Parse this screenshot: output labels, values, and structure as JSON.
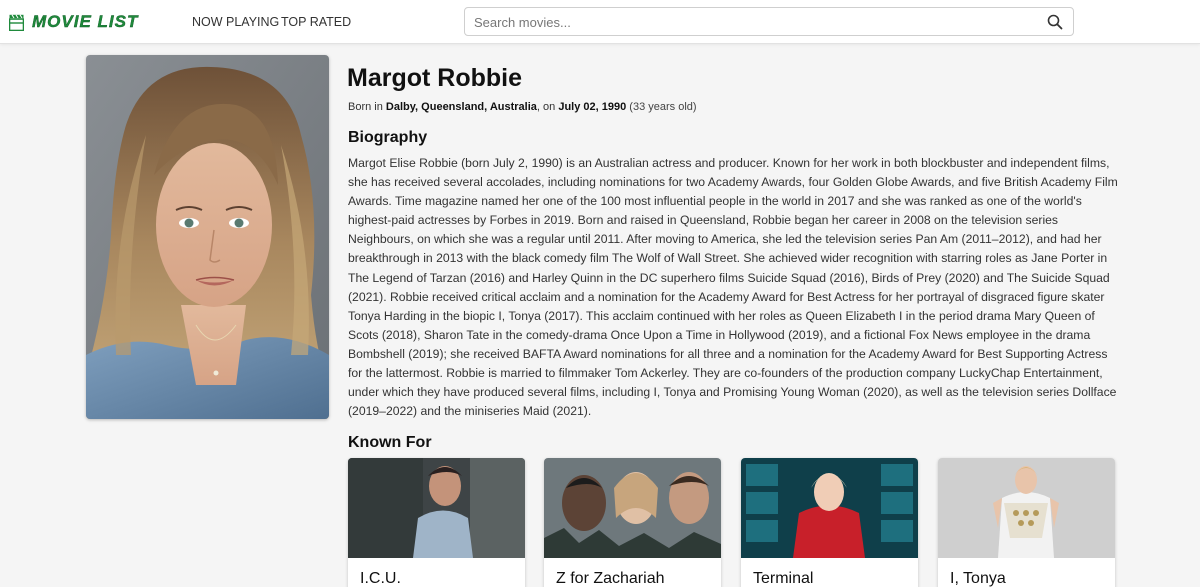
{
  "navbar": {
    "logo_text": "Movie List",
    "links": [
      "NOW PLAYING",
      "TOP RATED"
    ],
    "search_placeholder": "Search movies..."
  },
  "person": {
    "name": "Margot Robbie",
    "born_prefix": "Born in",
    "birthplace": "Dalby, Queensland, Australia",
    "on_text": ", on",
    "birthdate": "July 02, 1990",
    "age": "(33 years old)"
  },
  "biography": {
    "heading": "Biography",
    "text": "Margot Elise Robbie (born July 2, 1990) is an Australian actress and producer. Known for her work in both blockbuster and independent films, she has received several accolades, including nominations for two Academy Awards, four Golden Globe Awards, and five British Academy Film Awards. Time magazine named her one of the 100 most influential people in the world in 2017 and she was ranked as one of the world's highest-paid actresses by Forbes in 2019. Born and raised in Queensland, Robbie began her career in 2008 on the television series Neighbours, on which she was a regular until 2011. After moving to America, she led the television series Pan Am (2011–2012), and had her breakthrough in 2013 with the black comedy film The Wolf of Wall Street. She achieved wider recognition with starring roles as Jane Porter in The Legend of Tarzan (2016) and Harley Quinn in the DC superhero films Suicide Squad (2016), Birds of Prey (2020) and The Suicide Squad (2021). Robbie received critical acclaim and a nomination for the Academy Award for Best Actress for her portrayal of disgraced figure skater Tonya Harding in the biopic I, Tonya (2017). This acclaim continued with her roles as Queen Elizabeth I in the period drama Mary Queen of Scots (2018), Sharon Tate in the comedy-drama Once Upon a Time in Hollywood (2019), and a fictional Fox News employee in the drama Bombshell (2019); she received BAFTA Award nominations for all three and a nomination for the Academy Award for Best Supporting Actress for the lattermost. Robbie is married to filmmaker Tom Ackerley. They are co-founders of the production company LuckyChap Entertainment, under which they have produced several films, including I, Tonya and Promising Young Woman (2020), as well as the television series Dollface (2019–2022) and the miniseries Maid (2021)."
  },
  "known_for": {
    "heading": "Known For",
    "movies": [
      {
        "title": "I.C.U."
      },
      {
        "title": "Z for Zachariah"
      },
      {
        "title": "Terminal"
      },
      {
        "title": "I, Tonya"
      }
    ]
  },
  "colors": {
    "logo_green": "#1f8a3c",
    "page_bg": "#f5f5f5"
  }
}
